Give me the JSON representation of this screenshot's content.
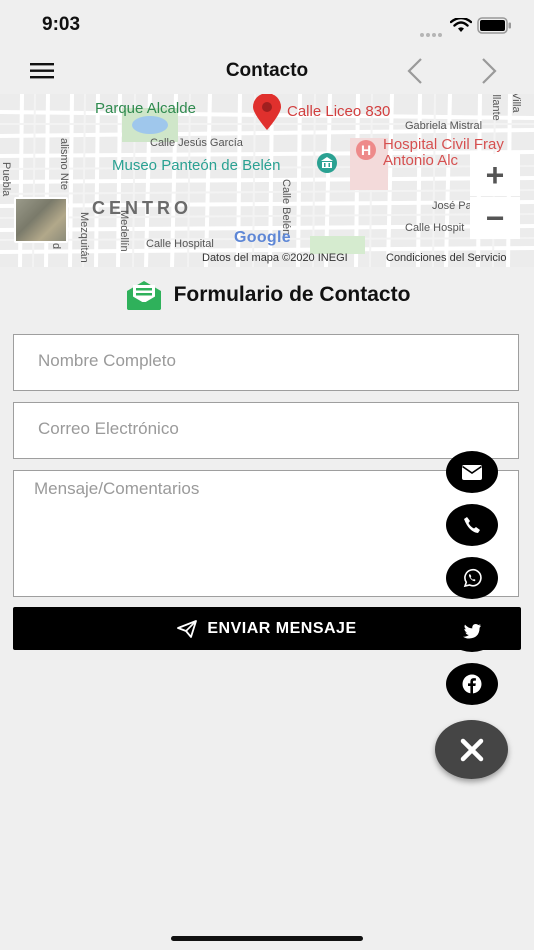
{
  "status": {
    "time": "9:03"
  },
  "nav": {
    "title": "Contacto"
  },
  "map": {
    "park": "Parque Alcalde",
    "address_pin": "Calle Liceo 830",
    "street_gabriela": "Gabriela Mistral",
    "street_jesus": "Calle Jesús García",
    "museum": "Museo Panteón de Belén",
    "hospital_line1": "Hospital Civil Fray",
    "hospital_line2": "Antonio Alc",
    "centro": "CENTRO",
    "street_jose": "José Pa",
    "street_hospital_right": "Calle Hospit",
    "street_hospital": "Calle Hospital",
    "street_belen": "Calle Belén",
    "street_medellin": "Medellín",
    "street_mezquitan": "Mezquitán",
    "street_puebla": "Puebla",
    "street_alismo": "alismo Nte",
    "street_calz": "Calz d",
    "street_villa": "Villa",
    "street_plante": "illante",
    "google": "Google",
    "credit_data": "Datos del mapa ©2020 INEGI",
    "credit_terms": "Condiciones del Servicio",
    "zoom_in": "+",
    "zoom_out": "−"
  },
  "form": {
    "title": "Formulario de Contacto",
    "name_placeholder": "Nombre Completo",
    "email_placeholder": "Correo Electrónico",
    "message_placeholder": "Mensaje/Comentarios",
    "send_label": "ENVIAR MENSAJE"
  },
  "fabs": [
    "email-icon",
    "phone-icon",
    "whatsapp-icon",
    "twitter-icon",
    "facebook-icon",
    "close-icon"
  ],
  "colors": {
    "accent_green": "#2fb15b",
    "pin_red": "#e0302d",
    "fab_dark": "#000000",
    "fab_main": "#454545"
  }
}
